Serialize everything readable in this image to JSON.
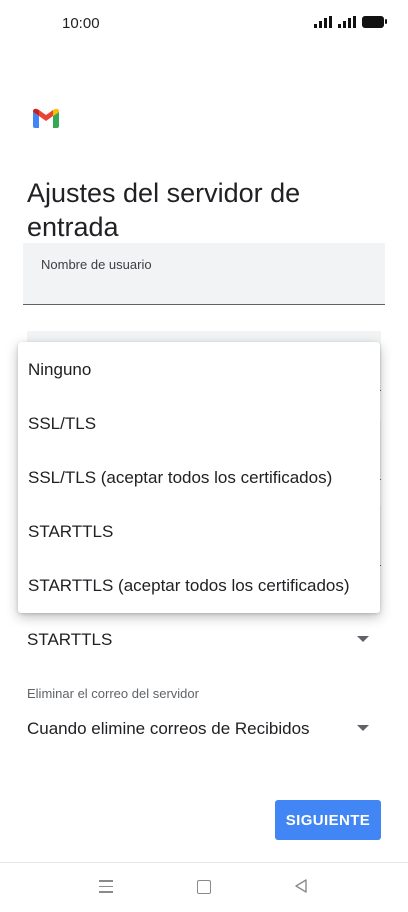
{
  "status_bar": {
    "time": "10:00"
  },
  "header": {
    "title": "Ajustes del servidor de entrada"
  },
  "username_field": {
    "label": "Nombre de usuario"
  },
  "security_dropdown": {
    "options": [
      "Ninguno",
      "SSL/TLS",
      "SSL/TLS (aceptar todos los certificados)",
      "STARTTLS",
      "STARTTLS (aceptar todos los certificados)"
    ],
    "selected": "STARTTLS"
  },
  "delete_mail": {
    "label": "Eliminar el correo del servidor",
    "selected": "Cuando elimine correos de Recibidos"
  },
  "actions": {
    "next_label": "SIGUIENTE"
  },
  "colors": {
    "accent": "#4285f4",
    "field_bg": "#f1f3f4"
  },
  "icons": [
    "gmail-logo-icon",
    "signal-icon",
    "battery-icon",
    "nav-menu-icon",
    "nav-home-icon",
    "nav-back-icon"
  ]
}
